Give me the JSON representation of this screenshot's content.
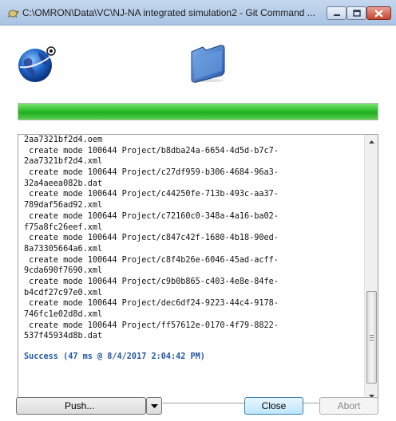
{
  "window": {
    "title": "C:\\OMRON\\Data\\VC\\NJ-NA integrated simulation2 - Git Command ...",
    "controls": {
      "minimize": "minimize",
      "maximize": "maximize",
      "close": "close"
    }
  },
  "icons": {
    "app": "git-globe-icon",
    "folder": "folder-icon",
    "title": "git-tortoise-icon"
  },
  "progress": {
    "fraction": 1.0,
    "color": "#2cbd2a"
  },
  "log": {
    "lines": [
      "2aa7321bf2d4.oem",
      " create mode 100644 Project/b8dba24a-6654-4d5d-b7c7-",
      "2aa7321bf2d4.xml",
      " create mode 100644 Project/c27df959-b306-4684-96a3-",
      "32a4aeea082b.dat",
      " create mode 100644 Project/c44250fe-713b-493c-aa37-",
      "789daf56ad92.xml",
      " create mode 100644 Project/c72160c0-348a-4a16-ba02-",
      "f75a8fc26eef.xml",
      " create mode 100644 Project/c847c42f-1680-4b18-90ed-",
      "8a73305664a6.xml",
      " create mode 100644 Project/c8f4b26e-6046-45ad-acff-",
      "9cda690f7690.xml",
      " create mode 100644 Project/c9b0b865-c403-4e8e-84fe-",
      "b4cdf27c97e0.xml",
      " create mode 100644 Project/dec6df24-9223-44c4-9178-",
      "746fc1e02d8d.xml",
      " create mode 100644 Project/ff57612e-0170-4f79-8822-",
      "537f45934d8b.dat"
    ],
    "success": "Success (47 ms @ 8/4/2017 2:04:42 PM)"
  },
  "buttons": {
    "push": "Push...",
    "close": "Close",
    "abort": "Abort"
  }
}
